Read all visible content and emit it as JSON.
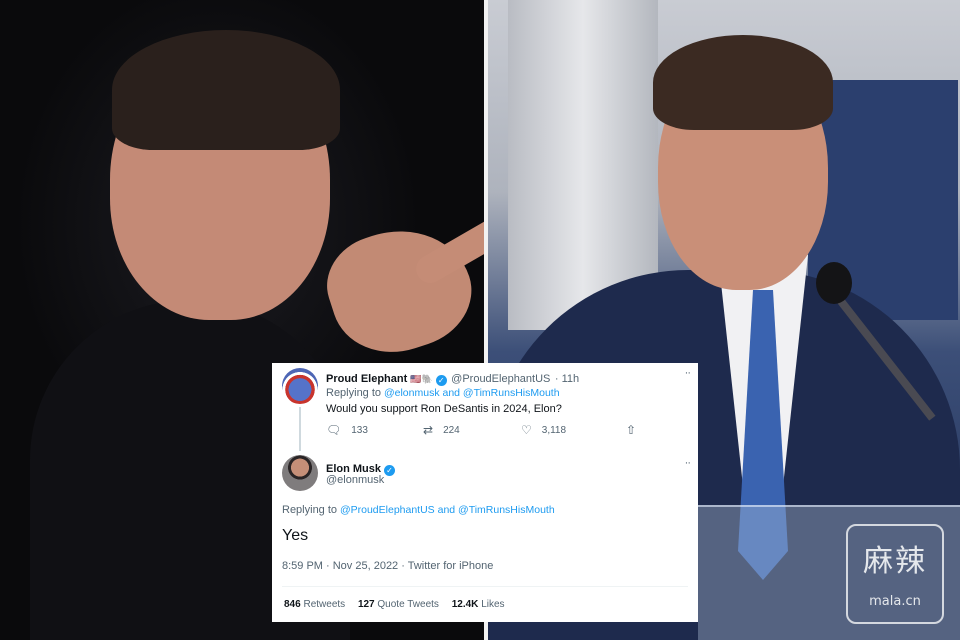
{
  "reply_tweet": {
    "name": "Proud Elephant",
    "flags": "🇺🇸🐘",
    "handle": "@ProudElephantUS",
    "time": "· 11h",
    "replying_prefix": "Replying to",
    "replying_to": "@elonmusk and @TimRunsHisMouth",
    "text": "Would you support Ron DeSantis in 2024, Elon?",
    "replies": "133",
    "retweets": "224",
    "likes": "3,118",
    "more": "··"
  },
  "main_tweet": {
    "name": "Elon Musk",
    "handle": "@elonmusk",
    "replying_prefix": "Replying to",
    "replying_to": "@ProudElephantUS and @TimRunsHisMouth",
    "text": "Yes",
    "timestamp": "8:59 PM · Nov 25, 2022 · Twitter for iPhone",
    "retweets_count": "846",
    "retweets_label": "Retweets",
    "quotes_count": "127",
    "quotes_label": "Quote Tweets",
    "likes_count": "12.4K",
    "likes_label": "Likes",
    "more": "··"
  },
  "watermark": {
    "characters": "麻辣",
    "site": "mala.cn"
  },
  "icons": {
    "reply": "reply-icon",
    "retweet": "retweet-icon",
    "like": "heart-icon",
    "share": "share-icon",
    "verified": "verified-badge-icon"
  },
  "colors": {
    "link": "#1d9bf0",
    "muted": "#536471",
    "text": "#0f1419"
  }
}
